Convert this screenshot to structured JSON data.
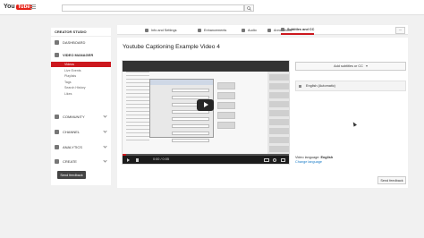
{
  "header": {
    "logo_you": "You",
    "logo_tube": "Tube",
    "search_placeholder": ""
  },
  "sidebar": {
    "heading": "CREATOR STUDIO",
    "items": [
      {
        "label": "DASHBOARD",
        "icon": "dashboard-icon"
      },
      {
        "label": "VIDEO MANAGER",
        "icon": "video-manager-icon"
      },
      {
        "label": "COMMUNITY",
        "icon": "community-icon"
      },
      {
        "label": "CHANNEL",
        "icon": "channel-icon"
      },
      {
        "label": "ANALYTICS",
        "icon": "analytics-icon"
      },
      {
        "label": "CREATE",
        "icon": "create-icon"
      }
    ],
    "subitems": [
      "Videos",
      "Live Events",
      "Playlists",
      "Tags",
      "Search History",
      "Likes"
    ],
    "send_feedback": "Send feedback"
  },
  "tabs": [
    {
      "label": "Info and Settings",
      "icon": "pencil-icon"
    },
    {
      "label": "Enhancements",
      "icon": "wand-icon"
    },
    {
      "label": "Audio",
      "icon": "music-icon"
    },
    {
      "label": "Annotations",
      "icon": "annotation-icon"
    },
    {
      "label": "Subtitles and CC",
      "icon": "subtitles-icon"
    }
  ],
  "more_button": "···",
  "video": {
    "title": "Youtube Captioning Example Video 4",
    "time": "0:00 / 0:05",
    "progress": 0.02
  },
  "captions": {
    "add_button": "Add subtitles or CC",
    "track_label": "English (Automatic)",
    "video_language_label": "Video language:",
    "video_language_value": "English",
    "change_language": "Change language"
  },
  "footer": {
    "send_feedback": "Send feedback"
  },
  "colors": {
    "accent": "#cc181e",
    "link": "#167ac6"
  }
}
